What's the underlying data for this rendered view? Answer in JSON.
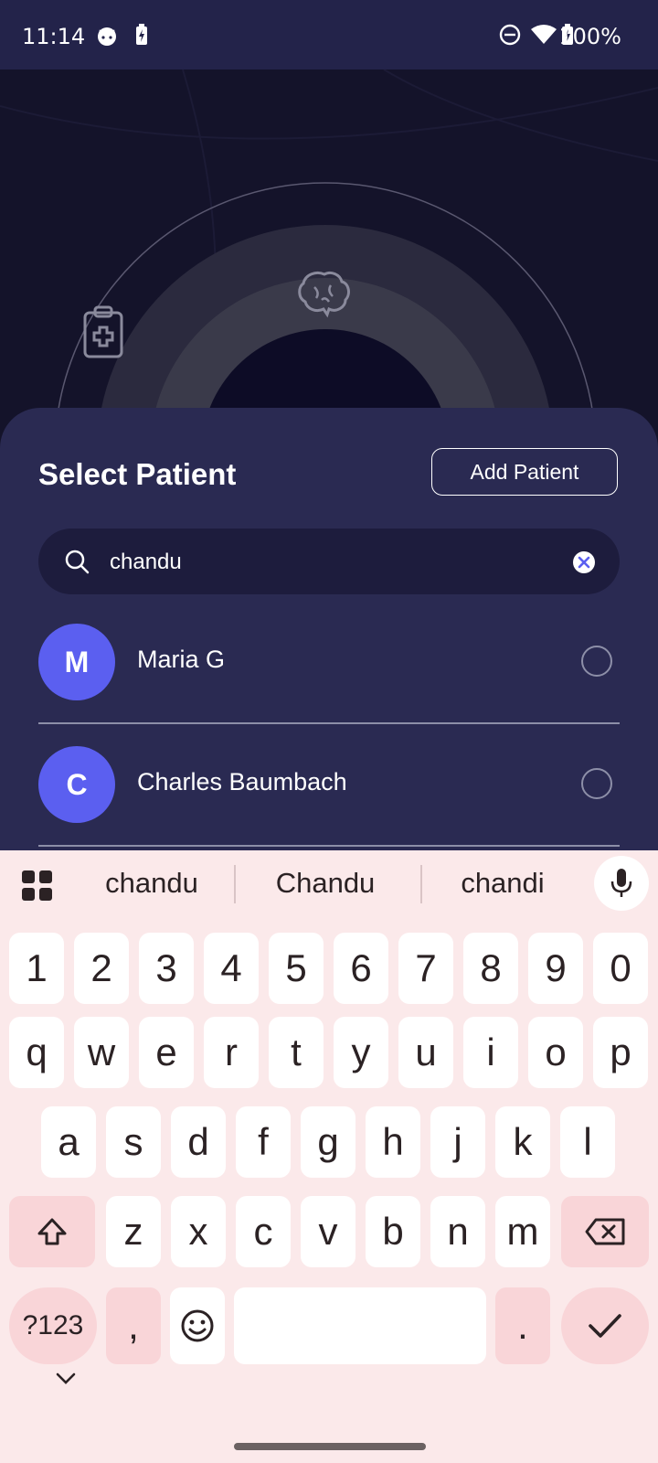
{
  "status_bar": {
    "time": "11:14",
    "battery": "100%",
    "icons": [
      "cat-notification-icon",
      "battery-saver-icon",
      "do-not-disturb-icon",
      "wifi-icon",
      "battery-charging-icon"
    ]
  },
  "background": {
    "icons": [
      "clipboard-medical-icon",
      "brain-icon"
    ]
  },
  "sheet": {
    "title": "Select Patient",
    "add_button": "Add Patient",
    "search": {
      "value": "chandu",
      "placeholder": ""
    },
    "patients": [
      {
        "initial": "M",
        "name": "Maria G"
      },
      {
        "initial": "C",
        "name": "Charles Baumbach"
      }
    ],
    "colors": {
      "sheet": "#2a2a52",
      "avatar": "#5b5ff0",
      "search": "#1d1c3d"
    }
  },
  "keyboard": {
    "suggestions": [
      "chandu",
      "Chandu",
      "chandi"
    ],
    "row_numbers": [
      "1",
      "2",
      "3",
      "4",
      "5",
      "6",
      "7",
      "8",
      "9",
      "0"
    ],
    "row1": [
      "q",
      "w",
      "e",
      "r",
      "t",
      "y",
      "u",
      "i",
      "o",
      "p"
    ],
    "row2": [
      "a",
      "s",
      "d",
      "f",
      "g",
      "h",
      "j",
      "k",
      "l"
    ],
    "row3": [
      "z",
      "x",
      "c",
      "v",
      "b",
      "n",
      "m"
    ],
    "symbols_key": "?123",
    "comma_key": ",",
    "period_key": ".",
    "colors": {
      "background": "#fbe9ea",
      "accent_key": "#f9d5d8"
    }
  }
}
